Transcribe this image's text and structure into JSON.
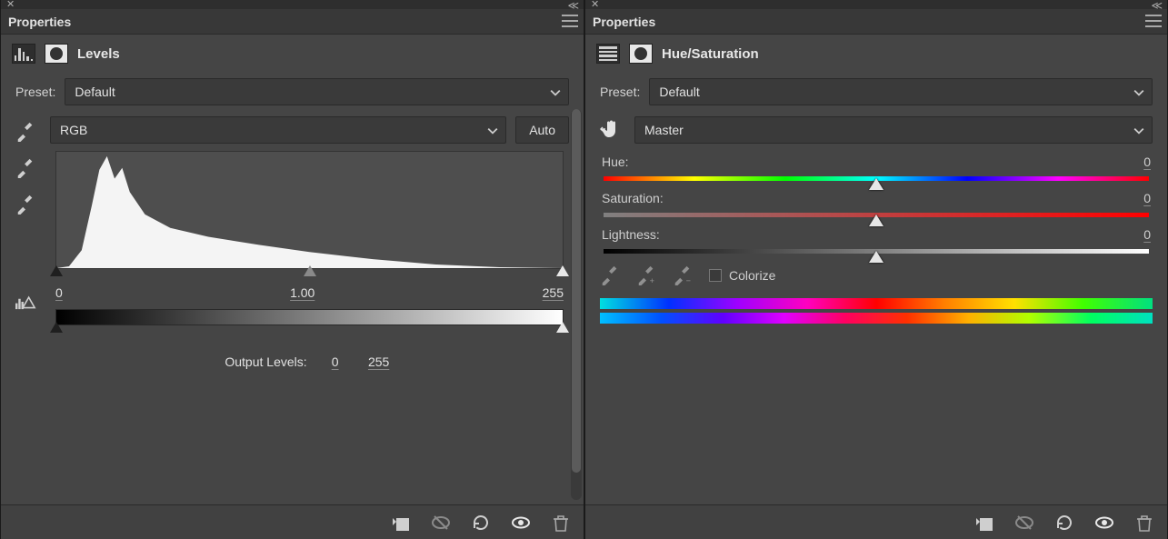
{
  "left": {
    "panel_title": "Properties",
    "adjustment_name": "Levels",
    "preset_label": "Preset:",
    "preset_value": "Default",
    "channel_value": "RGB",
    "auto_label": "Auto",
    "input_black": "0",
    "input_gamma": "1.00",
    "input_white": "255",
    "output_label": "Output Levels:",
    "output_black": "0",
    "output_white": "255"
  },
  "right": {
    "panel_title": "Properties",
    "adjustment_name": "Hue/Saturation",
    "preset_label": "Preset:",
    "preset_value": "Default",
    "edit_value": "Master",
    "hue_label": "Hue:",
    "hue_value": "0",
    "sat_label": "Saturation:",
    "sat_value": "0",
    "light_label": "Lightness:",
    "light_value": "0",
    "colorize_label": "Colorize",
    "colorize_checked": false
  }
}
